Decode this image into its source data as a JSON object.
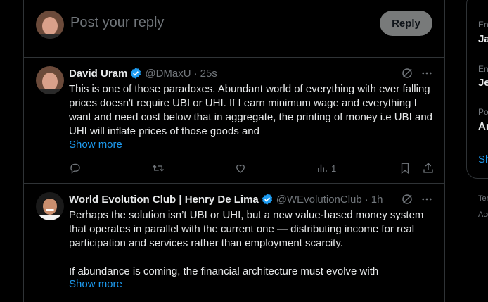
{
  "composer": {
    "placeholder": "Post your reply",
    "reply_label": "Reply"
  },
  "tweets": [
    {
      "name": "David Uram",
      "handle": "@DMaxU",
      "time": "25s",
      "text": "This is one of those paradoxes. Abundant world of everything with ever falling prices doesn't require UBI or UHI. If I earn minimum wage and everything I want and need cost below that in aggregate, the printing of money i.e UBI and UHI will inflate prices of those goods and",
      "show_more": "Show more",
      "views": "1"
    },
    {
      "name": "World Evolution Club | Henry De Lima",
      "handle": "@WEvolutionClub",
      "time": "1h",
      "text": "Perhaps the solution isn’t UBI or UHI, but a new value-based money system that operates in parallel with the current one — distributing income for real participation and services rather than employment scarcity.\n\nIf abundance is coming, the financial architecture must evolve with",
      "show_more": "Show more"
    }
  ],
  "sidebar": {
    "labels": [
      "En",
      "En",
      "Po"
    ],
    "values": [
      "Ja",
      "Je",
      "Ar"
    ],
    "show_link": "Sh",
    "footer": [
      "Ter",
      "Acc"
    ]
  },
  "colors": {
    "accent": "#1d9bf0",
    "muted": "#71767b",
    "border": "#2f3336"
  }
}
